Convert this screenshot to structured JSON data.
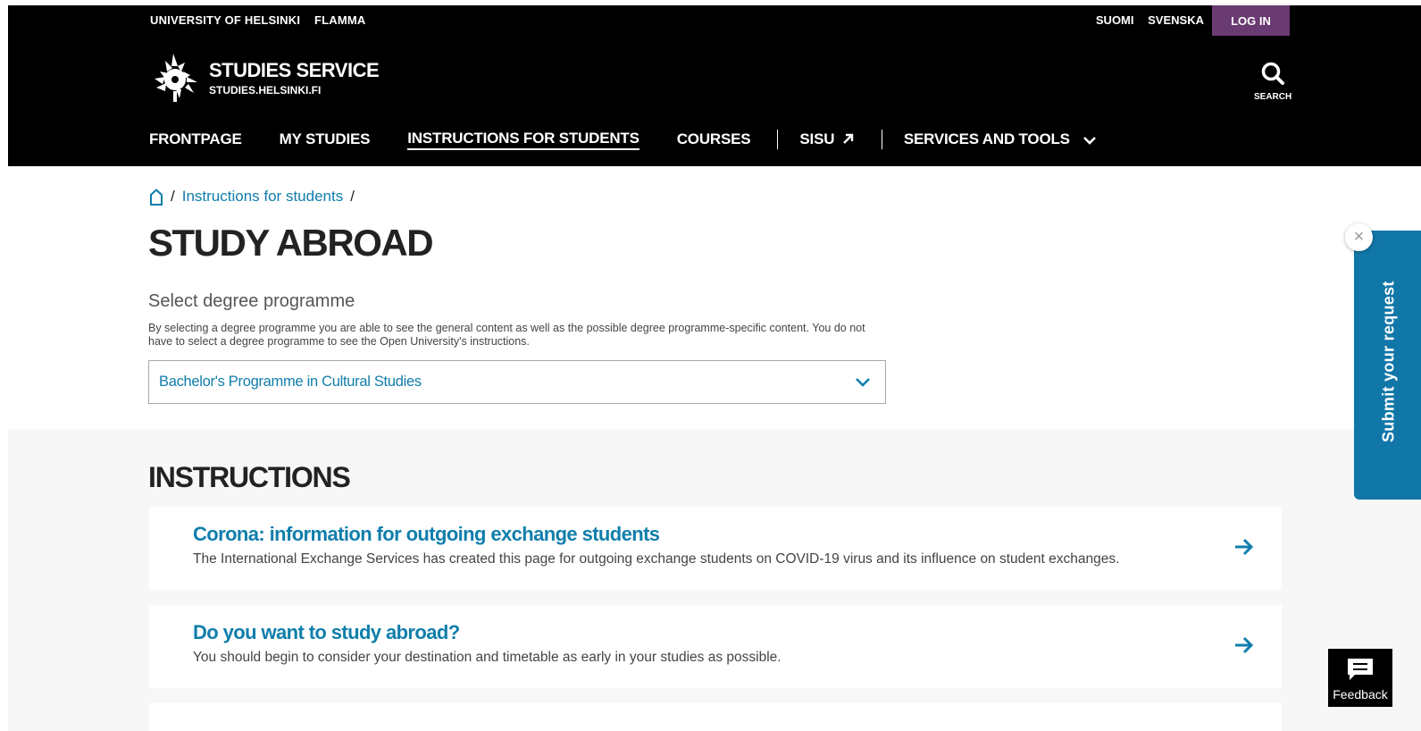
{
  "header": {
    "top_links": [
      "UNIVERSITY OF HELSINKI",
      "FLAMMA"
    ],
    "languages": [
      "SUOMI",
      "SVENSKA"
    ],
    "login_label": "LOG IN",
    "brand_title": "STUDIES SERVICE",
    "brand_subtitle": "STUDIES.HELSINKI.FI",
    "search_label": "SEARCH",
    "nav": {
      "frontpage": "FRONTPAGE",
      "my_studies": "MY STUDIES",
      "instructions": "INSTRUCTIONS FOR STUDENTS",
      "courses": "COURSES",
      "sisu": "SISU",
      "services": "SERVICES AND TOOLS"
    }
  },
  "breadcrumb": {
    "link": "Instructions for students"
  },
  "page_title": "STUDY ABROAD",
  "degree_select": {
    "label": "Select degree programme",
    "help": "By selecting a degree programme you are able to see the general content as well as the possible degree programme-specific content. You do not have to select a degree programme to see the Open University's instructions.",
    "selected": "Bachelor's Programme in Cultural Studies"
  },
  "instructions": {
    "heading": "INSTRUCTIONS",
    "cards": [
      {
        "title": "Corona: information for outgoing exchange students",
        "desc": "The International Exchange Services has created this page for outgoing exchange students on COVID-19 virus and its influence on student exchanges."
      },
      {
        "title": "Do you want to study abroad?",
        "desc": "You should begin to consider your destination and timetable as early in your studies as possible."
      }
    ]
  },
  "widgets": {
    "submit_request": "Submit your request",
    "close_symbol": "×",
    "feedback": "Feedback"
  },
  "colors": {
    "header_bg": "#000000",
    "login_bg": "#6a3a72",
    "link": "#107eab",
    "submit_tab": "#1176a8"
  }
}
